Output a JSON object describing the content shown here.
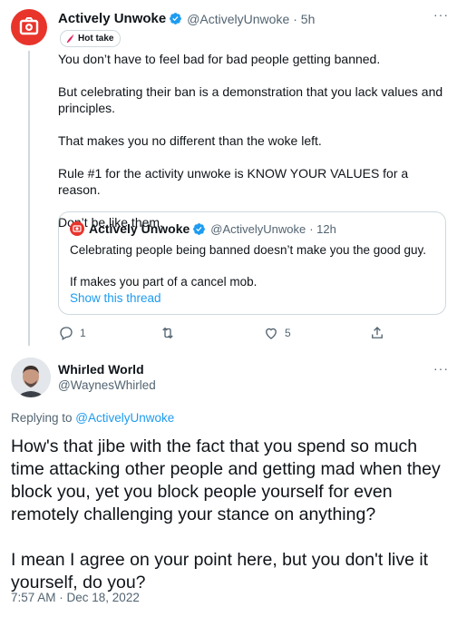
{
  "tweet": {
    "author_name": "Actively Unwoke",
    "handle": "@ActivelyUnwoke",
    "time": "· 5h",
    "badge": "Hot take",
    "more": "···",
    "text": "You don’t have to feel bad for bad people getting banned.\n\nBut celebrating their ban is a demonstration that you lack values and principles.\n\nThat makes you no different than the woke left.\n\nRule #1 for the activity unwoke is KNOW YOUR VALUES for a reason.\n\nDon’t be like them."
  },
  "quote": {
    "author_name": "Actively Unwoke",
    "handle": "@ActivelyUnwoke",
    "time": "· 12h",
    "line1": "Celebrating people being banned doesn’t make you the good guy.",
    "line2": "If makes you part of a cancel mob.",
    "show_thread": "Show this thread"
  },
  "actions": {
    "replies": "1",
    "retweets": "",
    "likes": "5"
  },
  "reply": {
    "author_name": "Whirled World",
    "handle": "@WaynesWhirled",
    "more": "···",
    "replying_prefix": "Replying to ",
    "replying_to": "@ActivelyUnwoke",
    "text": "How's that jibe with the fact that you spend so much time attacking other people and getting mad when they block you, yet you block people yourself for even remotely challenging your stance on anything?\n\nI mean I agree on your point here, but you don't live it yourself, do you?",
    "timestamp": "7:57 AM · Dec 18, 2022"
  },
  "colors": {
    "accent": "#1d9bf0",
    "brand_red": "#e8342b",
    "text": "#0f1419",
    "muted": "#536471"
  },
  "icons": [
    "logo-icon",
    "verified-icon",
    "flame-icon",
    "reply-icon",
    "retweet-icon",
    "like-icon",
    "share-icon",
    "more-icon"
  ]
}
